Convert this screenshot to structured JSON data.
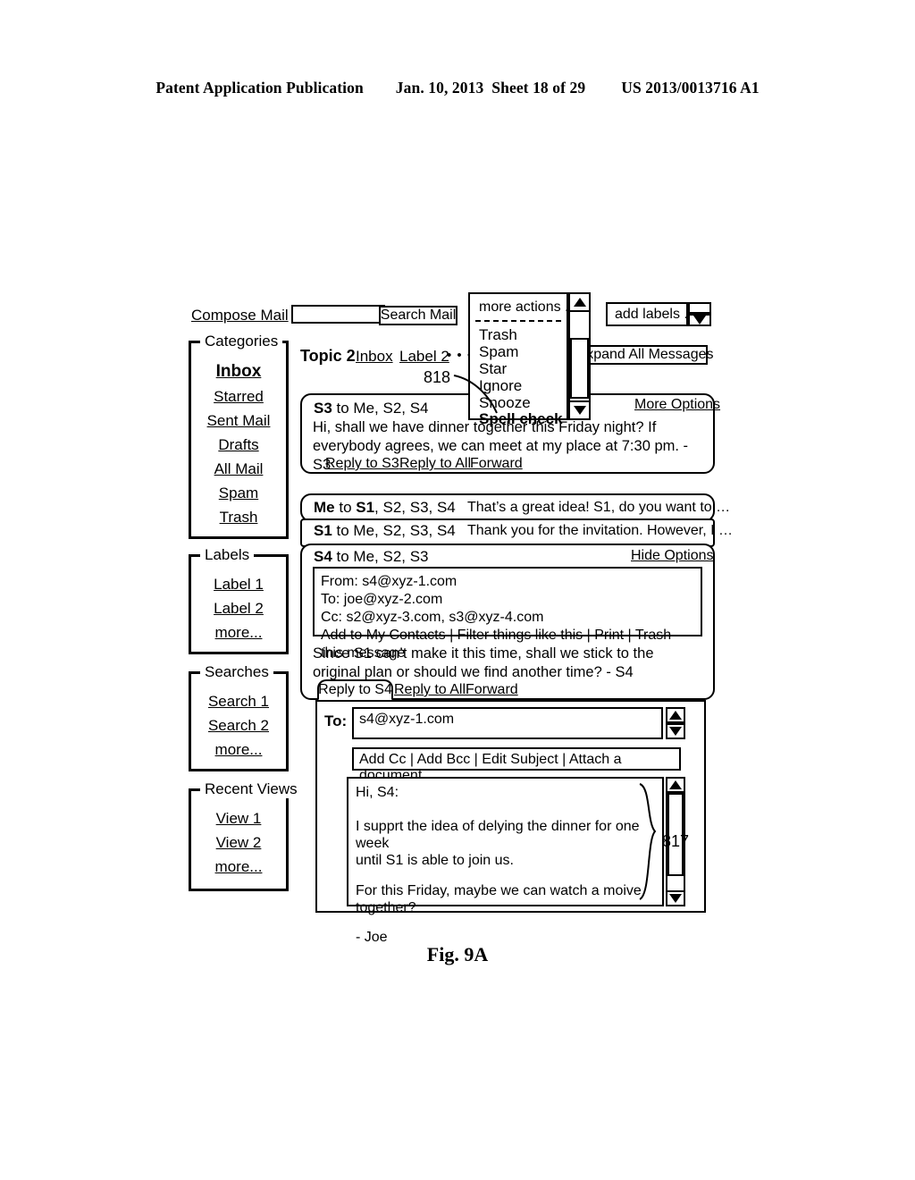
{
  "patent": {
    "publication": "Patent Application Publication",
    "date": "Jan. 10, 2013",
    "sheet": "Sheet 18 of 29",
    "number": "US 2013/0013716 A1",
    "figure_caption": "Fig. 9A"
  },
  "topbar": {
    "compose_label": "Compose Mail",
    "search_value": "",
    "search_placeholder": "",
    "search_button_label": "Search Mail"
  },
  "sidebar": {
    "groups": [
      {
        "title": "Categories",
        "items": [
          {
            "label": "Inbox",
            "current": true
          },
          {
            "label": "Starred",
            "current": false
          },
          {
            "label": "Sent Mail",
            "current": false
          },
          {
            "label": "Drafts",
            "current": false
          },
          {
            "label": "All Mail",
            "current": false
          },
          {
            "label": "Spam",
            "current": false
          },
          {
            "label": "Trash",
            "current": false
          }
        ]
      },
      {
        "title": "Labels",
        "items": [
          {
            "label": "Label 1",
            "current": false
          },
          {
            "label": "Label 2",
            "current": false
          },
          {
            "label": "more...",
            "current": false
          }
        ]
      },
      {
        "title": "Searches",
        "items": [
          {
            "label": "Search 1",
            "current": false
          },
          {
            "label": "Search 2",
            "current": false
          },
          {
            "label": "more...",
            "current": false
          }
        ]
      },
      {
        "title": "Recent Views",
        "items": [
          {
            "label": "View 1",
            "current": false
          },
          {
            "label": "View 2",
            "current": false
          },
          {
            "label": "more...",
            "current": false
          }
        ]
      }
    ]
  },
  "thread": {
    "topic": "Topic 2",
    "tags": [
      "Inbox",
      "Label 2"
    ],
    "more_dots": "• • •",
    "expand_all_label": "Expand All Messages"
  },
  "more_actions": {
    "title": "more actions ...",
    "items": [
      {
        "label": "Trash",
        "selected": false
      },
      {
        "label": "Spam",
        "selected": false
      },
      {
        "label": "Star",
        "selected": false
      },
      {
        "label": "Ignore",
        "selected": false
      },
      {
        "label": "Snooze",
        "selected": false
      },
      {
        "label": "Spell check",
        "selected": true
      }
    ]
  },
  "add_labels": {
    "label": "add labels ...",
    "arrow": "▼"
  },
  "messages": {
    "m1": {
      "sender": "S3",
      "recipients": " to Me, S2, S4",
      "body_line1": "Hi, shall we have dinner together this Friday night? If",
      "body_line2": "everybody agrees, we can meet at my place at 7:30 pm. - S3",
      "options_link": "More Options",
      "actions": [
        "Reply to S3",
        "Reply to All",
        "Forward"
      ]
    },
    "m2": {
      "sender": "Me",
      "recipients_pre": " to ",
      "recipient_bold": "S1",
      "recipients_post": ", S2, S3, S4",
      "snippet": "That’s a great idea!  S1, do you want to …"
    },
    "m3": {
      "sender": "S1",
      "recipients": " to Me, S2, S3, S4",
      "snippet": "Thank you for the invitation.  However, I …"
    },
    "m4": {
      "sender": "S4",
      "recipients": " to Me, S2, S3",
      "options_link": "Hide Options",
      "details": {
        "from": "From: s4@xyz-1.com",
        "to": "To: joe@xyz-2.com",
        "cc": "Cc: s2@xyz-3.com, s3@xyz-4.com",
        "actions": "Add to My Contacts | Filter things like this | Print | Trash this message"
      },
      "body_line1": "Since S1 can’t make it this time, shall we stick to the",
      "body_line2": "original plan or should we find another time? - S4",
      "tabs": [
        {
          "label": "Reply to S4",
          "active": true
        },
        {
          "label": "Reply to All",
          "active": false
        },
        {
          "label": "Forward",
          "active": false
        }
      ]
    }
  },
  "compose": {
    "to_label": "To:",
    "to_value": "s4@xyz-1.com",
    "options_bar": "Add Cc | Add Bcc | Edit Subject | Attach a document",
    "body_lines": [
      "Hi, S4:",
      "",
      "I supprt the idea of delying the dinner for one week",
      "until S1 is able to join us.",
      "",
      "For this Friday, maybe we can watch a moive together?",
      "",
      "- Joe"
    ]
  },
  "reference_numbers": {
    "dropdown": "818",
    "compose_body": "817"
  }
}
